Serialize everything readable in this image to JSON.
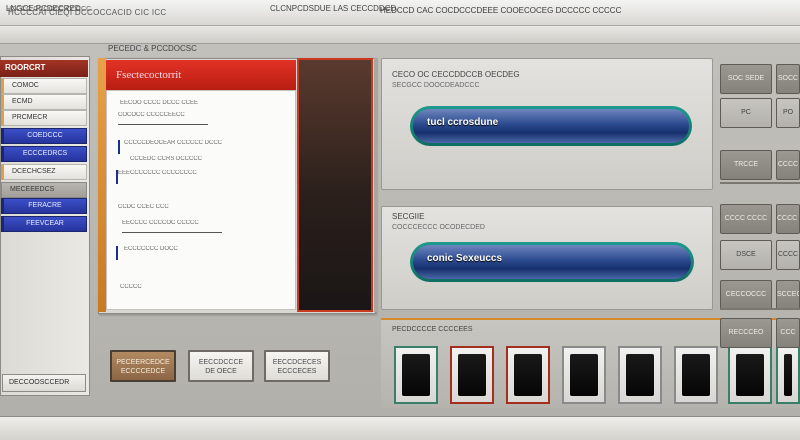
{
  "window": {
    "title": "HCCCCAI  CIEQI  DCCOCCACID  CIC  ICC"
  },
  "menubar": {
    "items": [
      "LNGCE PCDECRED",
      "CLCNPCDSDUE LAS CECCDDCD"
    ]
  },
  "sidebar": {
    "header": "ROORCRT",
    "items": [
      {
        "label": "COMOC",
        "style": "plain"
      },
      {
        "label": "ECMD",
        "style": "plain"
      },
      {
        "label": "PRCMECR",
        "style": "plain"
      },
      {
        "label": "COEDCCC",
        "style": "blue"
      },
      {
        "label": "ECCCEDRCS",
        "style": "blue"
      },
      {
        "label": "DCECHCSEZ",
        "style": "plain"
      },
      {
        "label": "MECEEEDCS",
        "style": "grey"
      },
      {
        "label": "FERACRE",
        "style": "blue"
      },
      {
        "label": "FEEVCEAR",
        "style": "blue"
      }
    ],
    "footer": "DECCOOSCCEDR"
  },
  "panel_strip_label": "PECEDC & PCCDOCSC",
  "document": {
    "header": "Fsectecoctorrit",
    "lines": [
      "EECOO CCCC DCCC CCEE",
      "COCOCC  CCCCCEECC",
      "CCCCCDEOCEAR CCCCCC  DCCC",
      "CCCEDC CCRS DCCCCC",
      "EEECCCCCCC CCCCCCCC",
      "CCDC CCEC  CCC",
      "EECCCC CCCCOC CCCCC",
      "ECCCCCCC DOCC",
      "CCCCC"
    ]
  },
  "left_buttons": [
    {
      "label": "PECEERCEDCE\nECCCCEDCE",
      "style": "brown"
    },
    {
      "label": "EECCDCCCE\nDE OECE",
      "style": "light"
    },
    {
      "label": "EECCDCECES\nECCCECES",
      "style": "light"
    }
  ],
  "groups": [
    {
      "title": "CECO OC CECCDDCCB OECDEG",
      "subtitle": "SECGCC DOOCDEADCCC",
      "track_label": "tucl ccrosdune"
    },
    {
      "title": "SECGIIE",
      "subtitle": "COCCCECCC OCODECDED",
      "track_label": "conic Sexeuccs"
    }
  ],
  "thumb_strip_label": "PECDCCCCE CCCCEES",
  "grid_buttons": [
    {
      "label": "SOC SEDE",
      "tone": "dark"
    },
    {
      "label": "SOCC",
      "tone": "dark"
    },
    {
      "label": "PC",
      "tone": "light"
    },
    {
      "label": "PO",
      "tone": "light"
    },
    {
      "label": "TRCCE",
      "tone": "dark"
    },
    {
      "label": "CCCC",
      "tone": "dark"
    },
    {
      "label": "CCCC CCCC",
      "tone": "dark"
    },
    {
      "label": "CCCC EE",
      "tone": "dark"
    },
    {
      "label": "DSCE",
      "tone": "light"
    },
    {
      "label": "CCCC",
      "tone": "light"
    },
    {
      "label": "CECCOCCC",
      "tone": "dark"
    },
    {
      "label": "SCCECC",
      "tone": "dark"
    },
    {
      "label": "RECCCEO",
      "tone": "dark"
    },
    {
      "label": "CCC",
      "tone": "dark"
    }
  ],
  "statusbar": {
    "left": "HCCCC  CCOCCC  CCCCC",
    "main": "HEDCCD  CAC  COCDCCCDEEE  COOECOCEG  DCCCCC  CCCCC"
  },
  "colors": {
    "accent_red": "#e23325",
    "sidebar_blue": "#2f3fb4",
    "track_teal": "#1d9b8e",
    "track_blue": "#2b4a8e"
  }
}
